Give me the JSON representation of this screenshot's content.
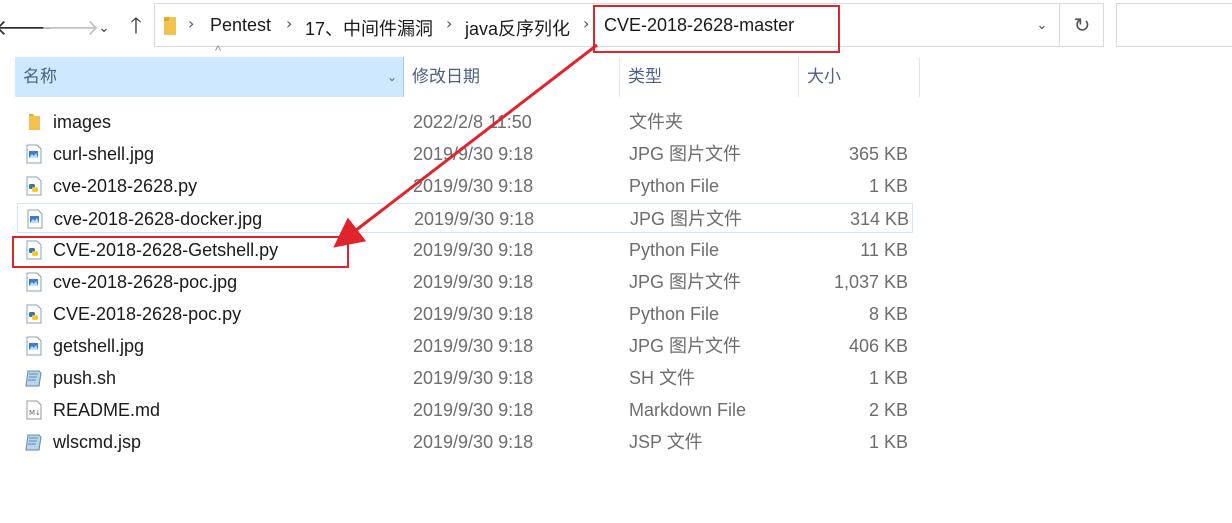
{
  "nav": {
    "back_icon": "arrow-left-icon",
    "forward_icon": "arrow-right-icon",
    "recent_icon": "chevron-down-icon",
    "up_icon": "arrow-up-icon",
    "glyphs": {
      "back": "🡐",
      "forward": "🡒",
      "recent": "⌄",
      "up": "🡑",
      "dropdown": "⌄",
      "refresh": "↻"
    }
  },
  "address": {
    "segments": [
      "Pentest",
      "17、中间件漏洞",
      "java反序列化",
      "CVE-2018-2628-master"
    ],
    "separator": "›"
  },
  "columns": {
    "name": "名称",
    "date": "修改日期",
    "type": "类型",
    "size": "大小",
    "sort_glyph": "^",
    "dropdown_glyph": "⌄"
  },
  "files": [
    {
      "name": "images",
      "date": "2022/2/8 11:50",
      "type": "文件夹",
      "size": "",
      "icon": "folder-icon"
    },
    {
      "name": "curl-shell.jpg",
      "date": "2019/9/30 9:18",
      "type": "JPG 图片文件",
      "size": "365 KB",
      "icon": "image-file-icon"
    },
    {
      "name": "cve-2018-2628.py",
      "date": "2019/9/30 9:18",
      "type": "Python File",
      "size": "1 KB",
      "icon": "python-file-icon"
    },
    {
      "name": "cve-2018-2628-docker.jpg",
      "date": "2019/9/30 9:18",
      "type": "JPG 图片文件",
      "size": "314 KB",
      "icon": "image-file-icon"
    },
    {
      "name": "CVE-2018-2628-Getshell.py",
      "date": "2019/9/30 9:18",
      "type": "Python File",
      "size": "11 KB",
      "icon": "python-file-icon"
    },
    {
      "name": "cve-2018-2628-poc.jpg",
      "date": "2019/9/30 9:18",
      "type": "JPG 图片文件",
      "size": "1,037 KB",
      "icon": "image-file-icon"
    },
    {
      "name": "CVE-2018-2628-poc.py",
      "date": "2019/9/30 9:18",
      "type": "Python File",
      "size": "8 KB",
      "icon": "python-file-icon"
    },
    {
      "name": "getshell.jpg",
      "date": "2019/9/30 9:18",
      "type": "JPG 图片文件",
      "size": "406 KB",
      "icon": "image-file-icon"
    },
    {
      "name": "push.sh",
      "date": "2019/9/30 9:18",
      "type": "SH 文件",
      "size": "1 KB",
      "icon": "shell-script-icon"
    },
    {
      "name": "README.md",
      "date": "2019/9/30 9:18",
      "type": "Markdown File",
      "size": "2 KB",
      "icon": "markdown-file-icon"
    },
    {
      "name": "wlscmd.jsp",
      "date": "2019/9/30 9:18",
      "type": "JSP 文件",
      "size": "1 KB",
      "icon": "jsp-file-icon"
    }
  ],
  "hovered_file": "cve-2018-2628-docker.jpg",
  "annotation": {
    "color": "#e0232d",
    "from": "CVE-2018-2628-master",
    "to": "CVE-2018-2628-Getshell.py"
  },
  "colors": {
    "header_selected": "#cde8ff",
    "header_text": "#4d6082",
    "secondary_text": "#6d6d6d",
    "folder": "#f2c14e"
  }
}
